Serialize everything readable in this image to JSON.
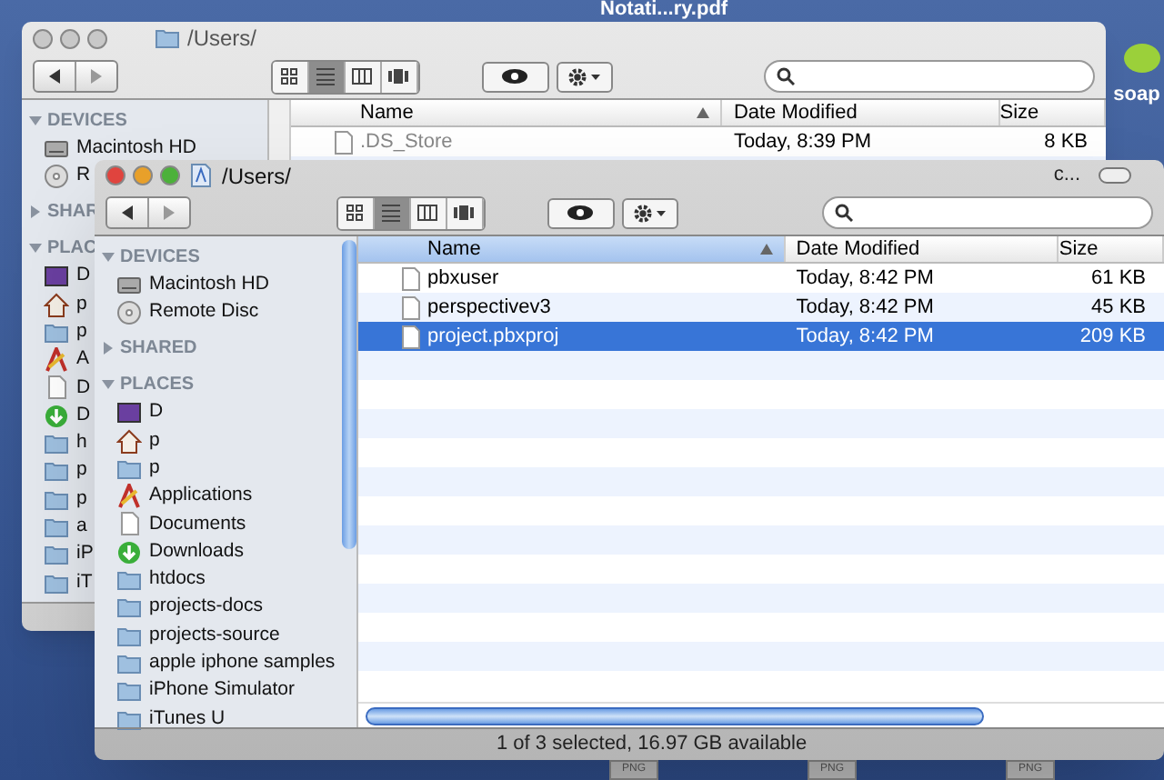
{
  "desktop": {
    "icons": [
      {
        "label": "Notati...ry.pdf"
      },
      {
        "label": "soap"
      }
    ],
    "png_tags": [
      "PNG",
      "PNG",
      "PNG"
    ]
  },
  "back_window": {
    "title": "/Users/",
    "views": [
      {
        "kind": "icon",
        "selected": false
      },
      {
        "kind": "list",
        "selected": true
      },
      {
        "kind": "column",
        "selected": false
      },
      {
        "kind": "coverflow",
        "selected": false
      }
    ],
    "sidebar": [
      {
        "header": "DEVICES",
        "expanded": true,
        "items": [
          {
            "label": "Macintosh HD",
            "kind": "drive"
          },
          {
            "label": "R",
            "kind": "disc"
          }
        ]
      },
      {
        "header": "SHAR",
        "expanded": false
      },
      {
        "header": "PLAC",
        "expanded": true,
        "items": [
          {
            "label": "D",
            "kind": "desktop"
          },
          {
            "label": "p",
            "kind": "home"
          },
          {
            "label": "p",
            "kind": "folder"
          },
          {
            "label": "A",
            "kind": "apps"
          },
          {
            "label": "D",
            "kind": "documents"
          },
          {
            "label": "D",
            "kind": "downloads"
          },
          {
            "label": "h",
            "kind": "folder"
          },
          {
            "label": "p",
            "kind": "folder"
          },
          {
            "label": "p",
            "kind": "folder"
          },
          {
            "label": "a",
            "kind": "folder"
          },
          {
            "label": "iP",
            "kind": "folder"
          },
          {
            "label": "iT",
            "kind": "folder"
          }
        ]
      }
    ],
    "columns": [
      {
        "label": "Name",
        "selected": false
      },
      {
        "label": "Date Modified",
        "selected": false
      },
      {
        "label": "Size",
        "selected": false
      }
    ],
    "rows": [
      {
        "name": ".DS_Store",
        "date": "Today, 8:39 PM",
        "size": "8 KB",
        "selected": false
      }
    ]
  },
  "front_window": {
    "title": "/Users/",
    "title_tail": "c...",
    "views": [
      {
        "kind": "icon",
        "selected": false
      },
      {
        "kind": "list",
        "selected": true
      },
      {
        "kind": "column",
        "selected": false
      },
      {
        "kind": "coverflow",
        "selected": false
      }
    ],
    "sidebar": [
      {
        "header": "DEVICES",
        "expanded": true,
        "items": [
          {
            "label": "Macintosh HD",
            "kind": "drive"
          },
          {
            "label": "Remote Disc",
            "kind": "disc"
          }
        ]
      },
      {
        "header": "SHARED",
        "expanded": false
      },
      {
        "header": "PLACES",
        "expanded": true,
        "items": [
          {
            "label": "D",
            "kind": "desktop"
          },
          {
            "label": "p",
            "kind": "home"
          },
          {
            "label": "p",
            "kind": "folder"
          },
          {
            "label": "Applications",
            "kind": "apps"
          },
          {
            "label": "Documents",
            "kind": "documents"
          },
          {
            "label": "Downloads",
            "kind": "downloads"
          },
          {
            "label": "htdocs",
            "kind": "folder"
          },
          {
            "label": "projects-docs",
            "kind": "folder"
          },
          {
            "label": "projects-source",
            "kind": "folder"
          },
          {
            "label": "apple iphone samples",
            "kind": "folder"
          },
          {
            "label": "iPhone Simulator",
            "kind": "folder"
          },
          {
            "label": "iTunes U",
            "kind": "folder"
          }
        ]
      }
    ],
    "columns": [
      {
        "label": "Name",
        "selected": true
      },
      {
        "label": "Date Modified",
        "selected": false
      },
      {
        "label": "Size",
        "selected": false
      }
    ],
    "rows": [
      {
        "name": "pbxuser",
        "date": "Today, 8:42 PM",
        "size": "61 KB",
        "selected": false
      },
      {
        "name": "perspectivev3",
        "date": "Today, 8:42 PM",
        "size": "45 KB",
        "selected": false
      },
      {
        "name": "project.pbxproj",
        "date": "Today, 8:42 PM",
        "size": "209 KB",
        "selected": true
      }
    ],
    "status_bar": "1 of 3 selected, 16.97 GB available"
  }
}
